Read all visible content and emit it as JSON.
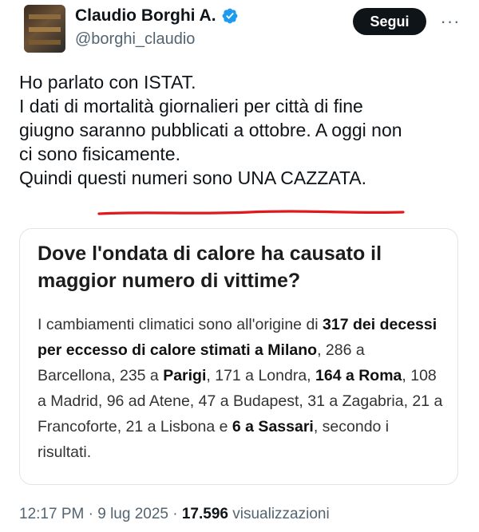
{
  "author": {
    "name": "Claudio Borghi A.",
    "handle": "@borghi_claudio",
    "verified_icon": "verified-badge-icon",
    "accent_color": "#1d9bf0"
  },
  "actions": {
    "follow_label": "Segui",
    "more_label": "···"
  },
  "tweet": {
    "lines": [
      "Ho parlato con ISTAT.",
      "I dati di mortalità giornalieri per città di fine",
      "giugno saranno pubblicati a ottobre. A oggi non",
      "ci sono fisicamente.",
      "Quindi questi numeri sono UNA CAZZATA."
    ],
    "underline_color": "#e0181b"
  },
  "card": {
    "title": "Dove l'ondata di calore ha causato il maggior numero di vittime?",
    "body": {
      "p1": "I cambiamenti climatici sono all'origine di ",
      "b1": "317 dei decessi per eccesso di calore stimati a Milano",
      "p2": ", 286 a Barcellona, 235 a ",
      "b2": "Parigi",
      "p3": ", 171 a Londra, ",
      "b3": "164 a Roma",
      "p4": ", 108 a Madrid, 96 ad Atene, 47 a Budapest, 31 a Zagabria, 21 a Francoforte, 21 a Lisbona e ",
      "b4": "6 a Sassari",
      "p5": ", secondo i risultati."
    }
  },
  "footer": {
    "time": "12:17 PM",
    "sep1": " · ",
    "date": "9 lug 2025",
    "sep2": " · ",
    "views_count": "17.596",
    "views_label": " visualizzazioni"
  }
}
